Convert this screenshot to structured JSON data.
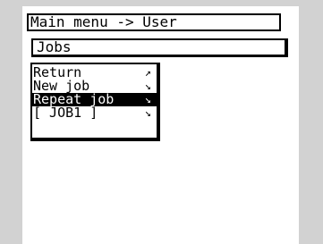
{
  "header": {
    "title": "Main menu -> User"
  },
  "submenu": {
    "title": "Jobs"
  },
  "menu": {
    "items": [
      {
        "label": "Return",
        "arrow": "↗",
        "selected": false
      },
      {
        "label": "New job",
        "arrow": "↘",
        "selected": false
      },
      {
        "label": "Repeat job",
        "arrow": "↘",
        "selected": true
      },
      {
        "label": "[ JOB1 ]",
        "arrow": "↘",
        "selected": false
      }
    ]
  },
  "colors": {
    "background": "#d2d2d2",
    "screen": "#ffffff",
    "ink": "#000000",
    "highlight_text": "#ffffff"
  }
}
